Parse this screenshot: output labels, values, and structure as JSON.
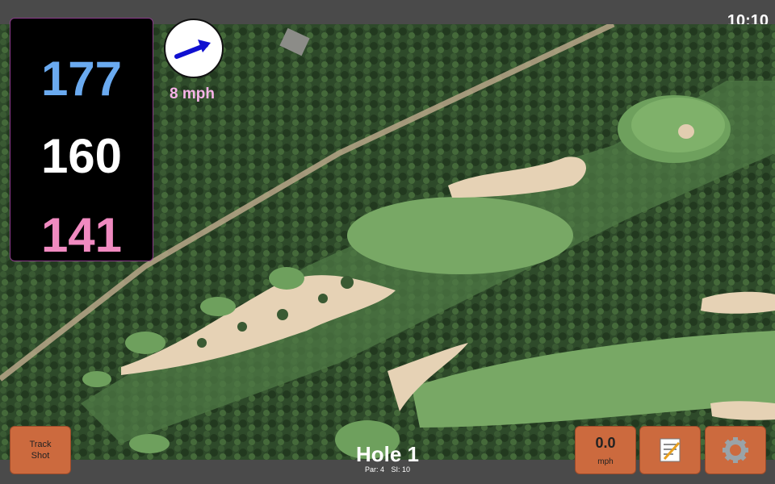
{
  "status_bar": {
    "time": "10:10"
  },
  "distances": {
    "back": "177",
    "middle": "160",
    "front": "141"
  },
  "wind": {
    "speed_label": "8 mph",
    "direction": "arrow-right-icon"
  },
  "buttons": {
    "track_shot_line1": "Track",
    "track_shot_line2": "Shot",
    "wind_value": "0.0",
    "wind_unit": "mph",
    "notes_icon": "notepad-icon",
    "settings_icon": "gear-icon"
  },
  "hole": {
    "title": "Hole 1",
    "par": "Par: 4",
    "si": "SI: 10"
  },
  "colors": {
    "back": "#6aaaf0",
    "middle": "#ffffff",
    "front": "#f08ac0",
    "button": "#cc6a3e",
    "wind_label": "#f8b4e8"
  }
}
